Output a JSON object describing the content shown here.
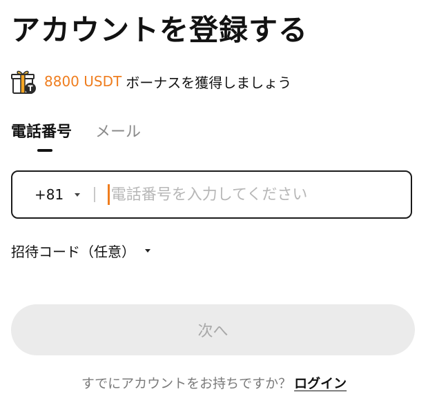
{
  "page": {
    "title": "アカウントを登録する"
  },
  "bonus": {
    "amount": "8800 USDT",
    "text": "ボーナスを獲得しましょう",
    "icon": "gift-box-icon",
    "accent_color": "#ef7d1e"
  },
  "tabs": [
    {
      "label": "電話番号",
      "active": true
    },
    {
      "label": "メール",
      "active": false
    }
  ],
  "phone": {
    "country_code": "+81",
    "value": "",
    "placeholder": "電話番号を入力してください"
  },
  "referral": {
    "label": "招待コード（任意）"
  },
  "next_button": {
    "label": "次へ",
    "enabled": false
  },
  "login": {
    "prompt": "すでにアカウントをお持ちですか？",
    "link_label": "ログイン"
  }
}
